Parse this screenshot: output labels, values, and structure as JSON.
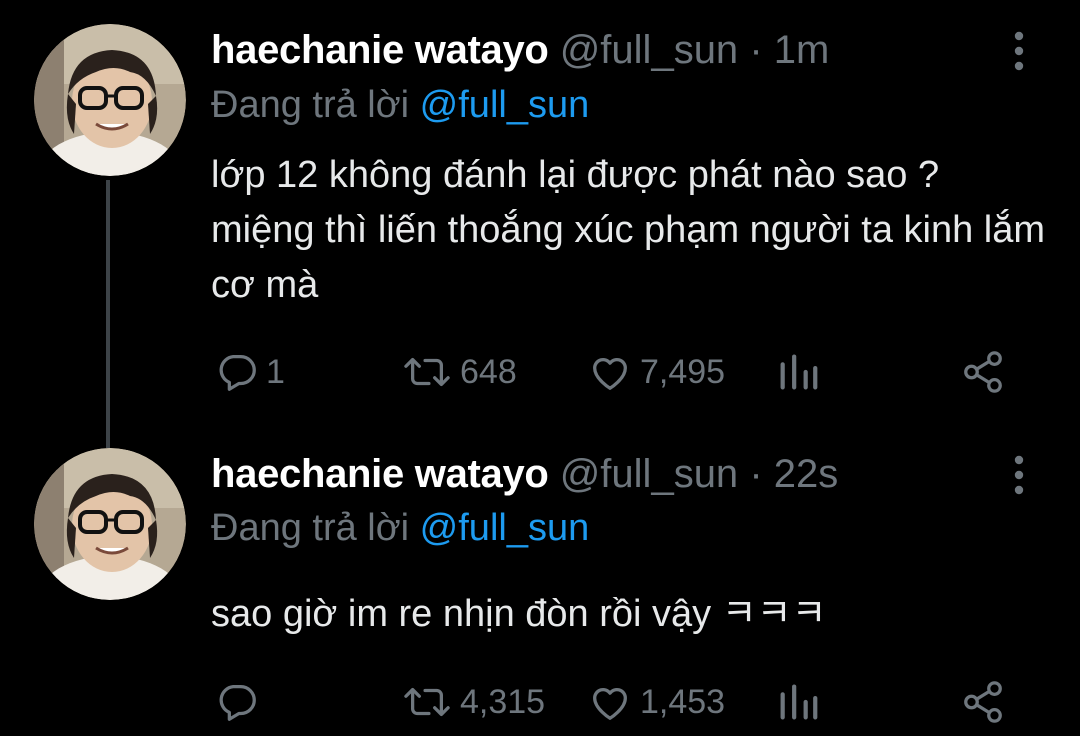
{
  "colors": {
    "background": "#000000",
    "text": "#e7e9ea",
    "muted": "#6e767d",
    "accent": "#1d9bf0",
    "thread_line": "#3d4348"
  },
  "tweets": [
    {
      "display_name": "haechanie watayo",
      "handle": "@full_sun",
      "separator": "·",
      "time": "1m",
      "reply_prefix": "Đang trả lời",
      "reply_to": "@full_sun",
      "text": "lớp 12 không đánh lại được phát nào sao ? miệng thì liến thoắng xúc phạm người ta kinh lắm cơ mà",
      "replies": "1",
      "retweets": "648",
      "likes": "7,495",
      "icons": [
        "avatar",
        "more-icon",
        "reply-icon",
        "retweet-icon",
        "like-icon",
        "views-icon",
        "share-icon"
      ]
    },
    {
      "display_name": "haechanie watayo",
      "handle": "@full_sun",
      "separator": "·",
      "time": "22s",
      "reply_prefix": "Đang trả lời",
      "reply_to": "@full_sun",
      "text": "sao giờ im re nhịn đòn rồi vậy ㅋㅋㅋ",
      "replies": "",
      "retweets": "4,315",
      "likes": "1,453",
      "icons": [
        "avatar",
        "more-icon",
        "reply-icon",
        "retweet-icon",
        "like-icon",
        "views-icon",
        "share-icon"
      ]
    }
  ]
}
